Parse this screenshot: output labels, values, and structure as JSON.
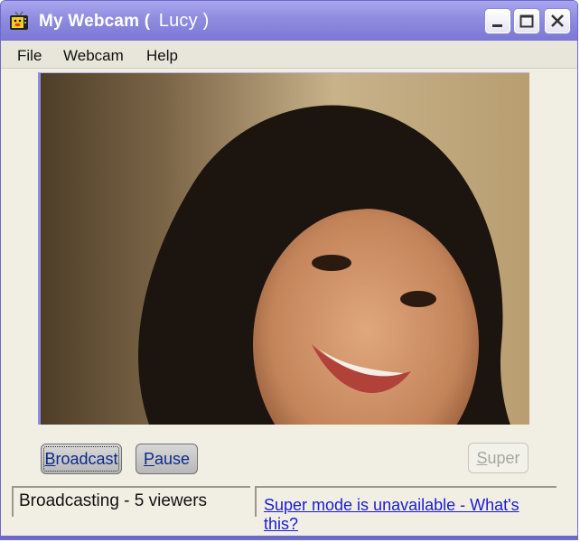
{
  "window": {
    "title": "My Webcam (",
    "user": "Lucy )",
    "controls": {
      "minimize": "minimize",
      "maximize": "maximize",
      "close": "close"
    }
  },
  "menu": [
    "File",
    "Webcam",
    "Help"
  ],
  "video": {
    "description": "Webcam video feed showing a smiling woman with curly dark hair"
  },
  "buttons": {
    "broadcast": {
      "access_key": "B",
      "rest": "roadcast",
      "state": "focused"
    },
    "pause": {
      "access_key": "P",
      "rest": "ause"
    },
    "super": {
      "access_key": "S",
      "rest": "uper",
      "state": "disabled"
    }
  },
  "status": {
    "text": "Broadcasting - 5 viewers"
  },
  "super_link": {
    "text": "Super mode is unavailable - What's this?"
  },
  "colors": {
    "title_bar": "#8f8ce0",
    "link": "#1a1ad8",
    "button_text": "#0a2a8a"
  }
}
